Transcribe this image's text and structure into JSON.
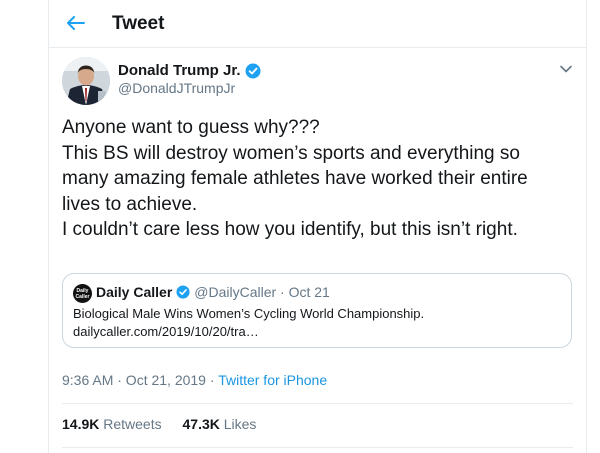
{
  "header": {
    "title": "Tweet"
  },
  "tweet": {
    "author_name": "Donald Trump Jr.",
    "author_handle": "@DonaldJTrumpJr",
    "text_lines": [
      "Anyone want to guess why???",
      "This BS will destroy women’s sports and everything so",
      "many amazing female athletes have worked their entire",
      "lives to achieve.",
      "I couldn’t care less how you identify, but this isn’t right."
    ],
    "timestamp": "9:36 AM · Oct 21, 2019",
    "separator": "·",
    "source": "Twitter for iPhone"
  },
  "quote": {
    "avatar_text": "Daily Caller",
    "name": "Daily Caller",
    "handle_date": "@DailyCaller · Oct 21",
    "text": "Biological Male Wins Women’s Cycling World Championship.",
    "link": "dailycaller.com/2019/10/20/tra…"
  },
  "stats": {
    "retweets_count": "14.9K",
    "retweets_label": "Retweets",
    "likes_count": "47.3K",
    "likes_label": "Likes"
  },
  "colors": {
    "accent": "#1da1f2",
    "link": "#1b95e0",
    "secondary_text": "#657786",
    "border": "#e6ecf0"
  },
  "icons": {
    "back": "arrow-left-icon",
    "verified": "verified-badge-icon",
    "more": "chevron-down-icon"
  }
}
